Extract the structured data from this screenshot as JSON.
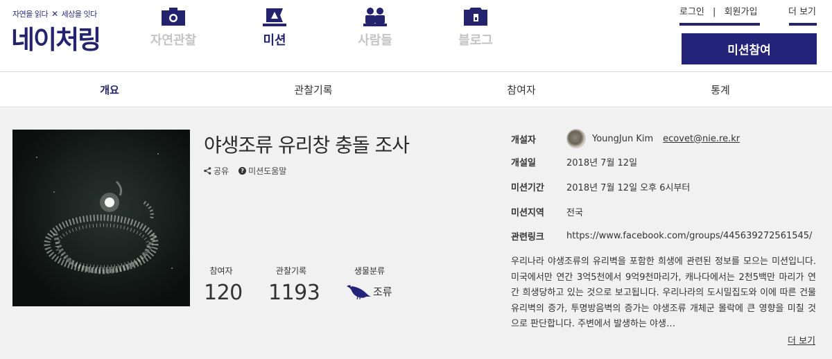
{
  "brand": {
    "slogan_a": "자연을 읽다",
    "slogan_sep": "✕",
    "slogan_b": "세상을 잇다",
    "name": "네이처링"
  },
  "topnav": [
    {
      "label": "자연관찰",
      "icon": "camera-icon",
      "active": false
    },
    {
      "label": "미션",
      "icon": "flag-icon",
      "active": true
    },
    {
      "label": "사람들",
      "icon": "people-icon",
      "active": false
    },
    {
      "label": "블로그",
      "icon": "blog-icon",
      "active": false
    }
  ],
  "util": {
    "login": "로그인",
    "sep": "|",
    "signup": "회원가입",
    "more": "더 보기"
  },
  "join_button": "미션참여",
  "tabs": [
    "개요",
    "관찰기록",
    "참여자",
    "통계"
  ],
  "mission": {
    "title": "야생조류 유리창 충돌 조사",
    "share": "공유",
    "help_glyph": "?",
    "help": "미션도움말",
    "stats": {
      "participants_label": "참여자",
      "participants": "120",
      "records_label": "관찰기록",
      "records": "1193",
      "bio_label": "생물분류",
      "bio": "조류",
      "bio_icon": "bird-icon"
    }
  },
  "info": {
    "creator_label": "개설자",
    "creator_name": "YoungJun Kim",
    "creator_email": "ecovet@nie.re.kr",
    "opened_label": "개설일",
    "opened": "2018년 7월 12일",
    "period_label": "미션기간",
    "period": "2018년 7월 12일 오후 6시부터",
    "region_label": "미션지역",
    "region": "전국",
    "link_label": "관련링크",
    "link": "https://www.facebook.com/groups/445639272561545/"
  },
  "description": "우리나라 야생조류의 유리벽을 포함한 희생에 관련된 정보를 모으는 미션입니다. 미국에서만 연간 3억5천에서 9억9천마리가, 캐나다에서는 2천5백만 마리가 연간 희생당하고 있는 것으로 보고됩니다. 우리나라의 도시밀집도와 이에 따른 건물 유리벽의 증가, 투명방음벽의 증가는 야생조류 개체군 몰락에 큰 영향을 미칠 것으로 판단합니다. 주변에서 발생하는 야생…",
  "desc_more": "더 보기",
  "colors": {
    "brand": "#23236e",
    "button": "#23237a",
    "inactive_nav": "#c4c4c4",
    "content_bg": "#f1f1f1"
  }
}
